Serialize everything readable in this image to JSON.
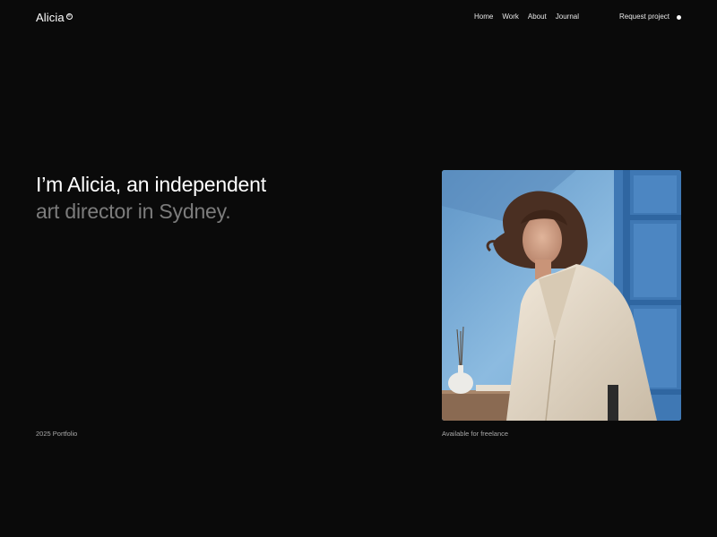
{
  "header": {
    "logo_text": "Alicia",
    "logo_mark": "®",
    "nav": [
      {
        "label": "Home"
      },
      {
        "label": "Work"
      },
      {
        "label": "About"
      },
      {
        "label": "Journal"
      }
    ],
    "cta_label": "Request project"
  },
  "hero": {
    "line1": "I’m Alicia, an independent",
    "line2": "art director in Sydney."
  },
  "footer": {
    "left_caption": "2025 Portfolio",
    "right_caption": "Available for freelance"
  },
  "colors": {
    "background": "#0a0a0a",
    "primary_text": "#ffffff",
    "muted_text": "#7c7c7c",
    "photo_wall": "#79a8d0"
  },
  "icons": {
    "status": "status-dot-icon",
    "photo": "portrait-photo"
  }
}
